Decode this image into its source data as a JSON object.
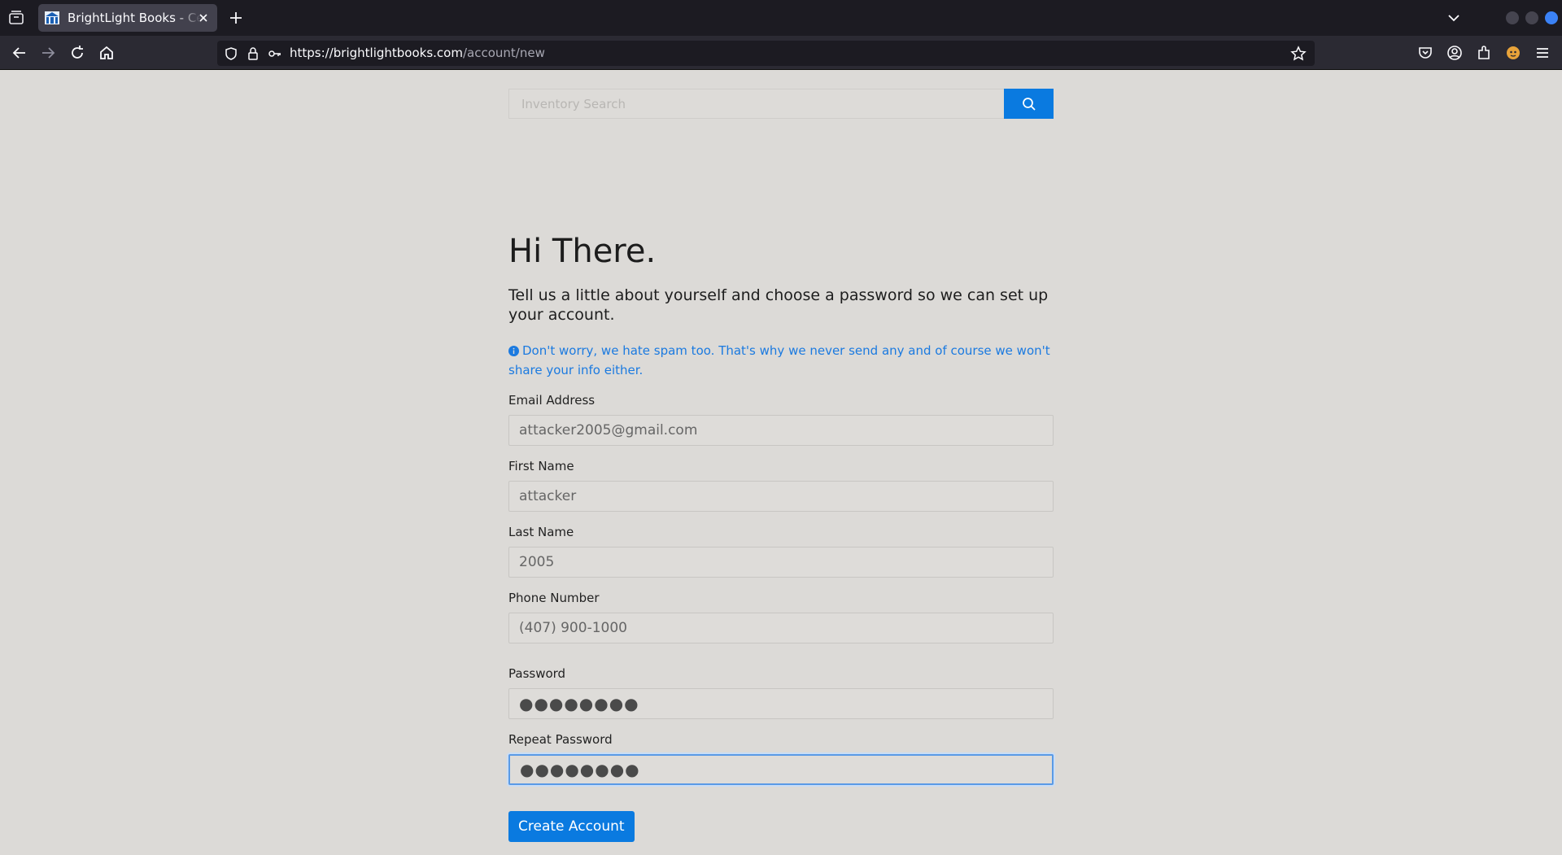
{
  "browser": {
    "tab_title": "BrightLight Books - Central Florida",
    "url_host": "https://brightlightbooks.com",
    "url_path": "/account/new"
  },
  "search": {
    "placeholder": "Inventory Search"
  },
  "form": {
    "heading": "Hi There.",
    "intro": "Tell us a little about yourself and choose a password so we can set up your account.",
    "note": "Don't worry, we hate spam too. That's why we never send any and of course we won't share your info either.",
    "email_label": "Email Address",
    "email_value": "attacker2005@gmail.com",
    "first_name_label": "First Name",
    "first_name_value": "attacker",
    "last_name_label": "Last Name",
    "last_name_value": "2005",
    "phone_label": "Phone Number",
    "phone_value": "(407) 900-1000",
    "password_label": "Password",
    "password_value": "●●●●●●●●",
    "repeat_password_label": "Repeat Password",
    "repeat_password_value": "●●●●●●●●",
    "submit_label": "Create Account"
  },
  "colors": {
    "accent": "#0a7ae0",
    "page_bg": "#dcdad7",
    "chrome_bg": "#1c1b22"
  }
}
